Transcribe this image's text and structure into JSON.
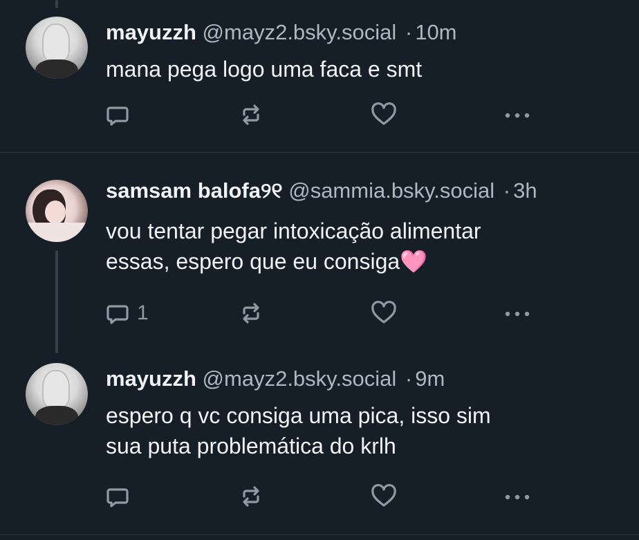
{
  "posts": [
    {
      "name": "mayuzzh",
      "handle": "@mayz2.bsky.social",
      "separator": "·",
      "time": "10m",
      "text_lines": [
        "mana pega logo uma faca e smt"
      ],
      "reply_count": "",
      "avatar_icon": "avatar-bw-photo"
    },
    {
      "name": "samsam balofa୨୧",
      "handle": "@sammia.bsky.social",
      "separator": "·",
      "time": "3h",
      "text_lines": [
        "vou tentar pegar intoxicação alimentar",
        "essas, espero que eu consiga"
      ],
      "emoji": "🩷",
      "reply_count": "1",
      "avatar_icon": "avatar-girl-photo"
    },
    {
      "name": "mayuzzh",
      "handle": "@mayz2.bsky.social",
      "separator": "·",
      "time": "9m",
      "text_lines": [
        "espero q vc consiga uma pica, isso sim",
        "sua puta problemática do krlh"
      ],
      "reply_count": "",
      "avatar_icon": "avatar-bw-photo"
    }
  ],
  "icons": {
    "reply": "comment-icon",
    "repost": "repost-icon",
    "like": "heart-icon",
    "more": "more-dots-icon"
  },
  "colors": {
    "background": "#161e27",
    "text": "#f1f3f5",
    "muted": "#aeb8c4",
    "icon": "#8f9aa7",
    "divider": "#2a3440"
  }
}
